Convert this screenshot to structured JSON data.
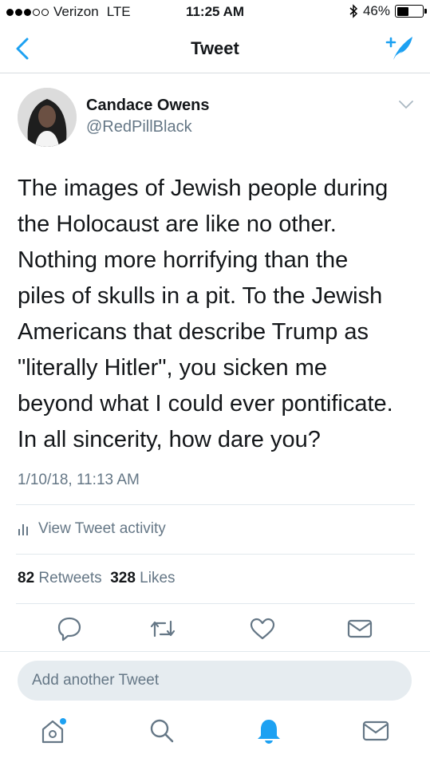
{
  "status_bar": {
    "carrier": "Verizon",
    "network": "LTE",
    "time": "11:25 AM",
    "battery_percent": "46%",
    "battery_level": 0.46
  },
  "nav": {
    "title": "Tweet",
    "back_icon": "chevron-left-icon",
    "compose_icon": "compose-tweet-icon",
    "accent_color": "#1da1f2"
  },
  "tweet": {
    "author_name": "Candace Owens",
    "author_handle": "@RedPillBlack",
    "text_lines": [
      "The images of Jewish people during",
      "the Holocaust are like no other.",
      "Nothing more horrifying than the",
      "piles of skulls in a pit. To the Jewish",
      "Americans that describe Trump as",
      "\"literally Hitler\", you sicken me",
      "beyond what I could ever pontificate.",
      "In all sincerity, how dare you?"
    ],
    "timestamp": "1/10/18, 11:13 AM",
    "activity_label": "View Tweet activity",
    "retweet_count": "82",
    "retweet_label": "Retweets",
    "like_count": "328",
    "like_label": "Likes"
  },
  "actions": [
    "reply-icon",
    "retweet-icon",
    "like-icon",
    "direct-message-icon"
  ],
  "reply_box": {
    "placeholder": "Add another Tweet"
  },
  "tab_bar": {
    "tabs": [
      "home-icon",
      "search-icon",
      "notifications-icon",
      "messages-icon"
    ],
    "active_tab": "notifications-icon"
  }
}
